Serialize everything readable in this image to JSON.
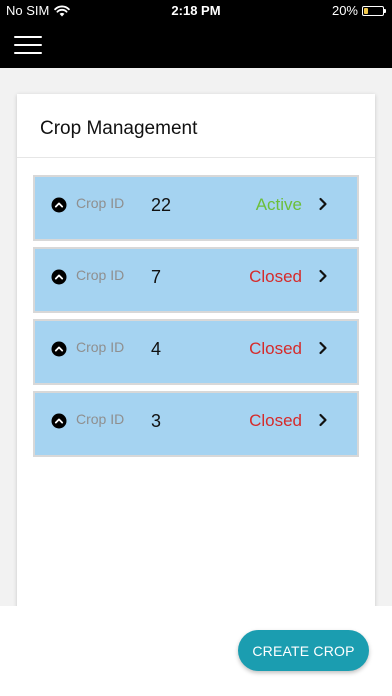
{
  "status_bar": {
    "carrier": "No SIM",
    "time": "2:18 PM",
    "battery": "20%",
    "battery_level": 0.2,
    "battery_color": "#f2c94c"
  },
  "nav": {
    "menu_icon": "hamburger-menu-icon"
  },
  "card": {
    "title": "Crop Management"
  },
  "crops": [
    {
      "label": "Crop ID",
      "id": "22",
      "status": "Active"
    },
    {
      "label": "Crop ID",
      "id": "7",
      "status": "Closed"
    },
    {
      "label": "Crop ID",
      "id": "4",
      "status": "Closed"
    },
    {
      "label": "Crop ID",
      "id": "3",
      "status": "Closed"
    }
  ],
  "colors": {
    "row_background": "#a5d3f1",
    "active": "#6cbf3a",
    "closed": "#d62b2b",
    "button": "#1b9db0"
  },
  "icons": {
    "expand": "chevron-up-circle-icon",
    "row_arrow": "chevron-right-icon"
  },
  "actions": {
    "create_label": "CREATE CROP"
  }
}
